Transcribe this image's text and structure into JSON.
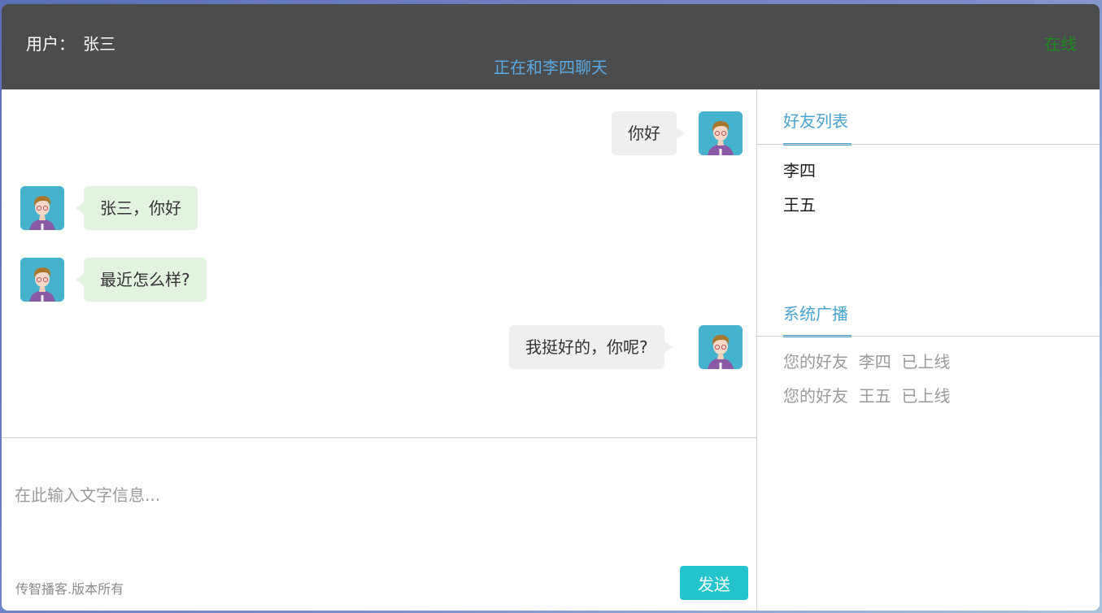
{
  "header": {
    "user_label": "用户：",
    "user_name": "张三",
    "chat_with": "正在和李四聊天",
    "status": "在线"
  },
  "messages": [
    {
      "side": "right",
      "text": "你好"
    },
    {
      "side": "left",
      "text": "张三，你好"
    },
    {
      "side": "left",
      "text": "最近怎么样?"
    },
    {
      "side": "right",
      "text": "我挺好的，你呢?"
    }
  ],
  "input": {
    "placeholder": "在此输入文字信息...",
    "value": ""
  },
  "footer": {
    "copyright": "传智播客.版本所有",
    "send_label": "发送"
  },
  "friends": {
    "title": "好友列表",
    "items": [
      "李四",
      "王五"
    ]
  },
  "broadcast": {
    "title": "系统广播",
    "items": [
      "您的好友  李四  已上线",
      "您的好友  王五  已上线"
    ]
  },
  "colors": {
    "header_bg": "#4b4c4e",
    "accent": "#4aa3cf",
    "status_online": "#1e8a1e",
    "send_button": "#24c4cc",
    "bubble_self": "#efefef",
    "bubble_other": "#e2f3e0"
  },
  "icons": {
    "avatar": "user-avatar-icon"
  }
}
